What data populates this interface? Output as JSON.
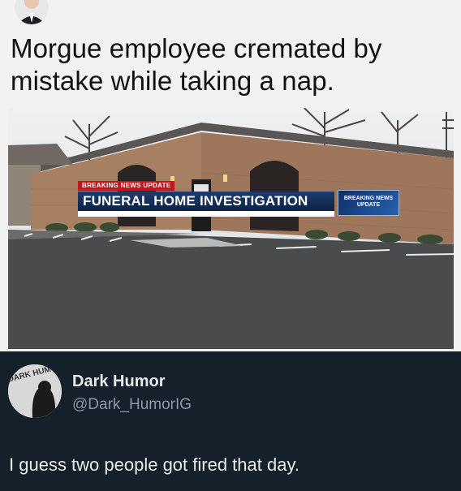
{
  "meme": {
    "headline": "Morgue employee cremated by mistake while taking a nap.",
    "ticker_top": "BREAKING NEWS UPDATE",
    "ticker_main": "FUNERAL HOME INVESTIGATION",
    "ticker_logo": "BREAKING NEWS UPDATE"
  },
  "tweet": {
    "avatar_text": "DARK HUMOR",
    "display_name": "Dark Humor",
    "handle": "@Dark_HumorIG",
    "text": "I guess two people got fired that day."
  },
  "colors": {
    "tweet_bg": "#15202b",
    "ticker_red": "#c0161c",
    "ticker_blue": "#1e3d6e",
    "handle_gray": "#8b98a5"
  }
}
